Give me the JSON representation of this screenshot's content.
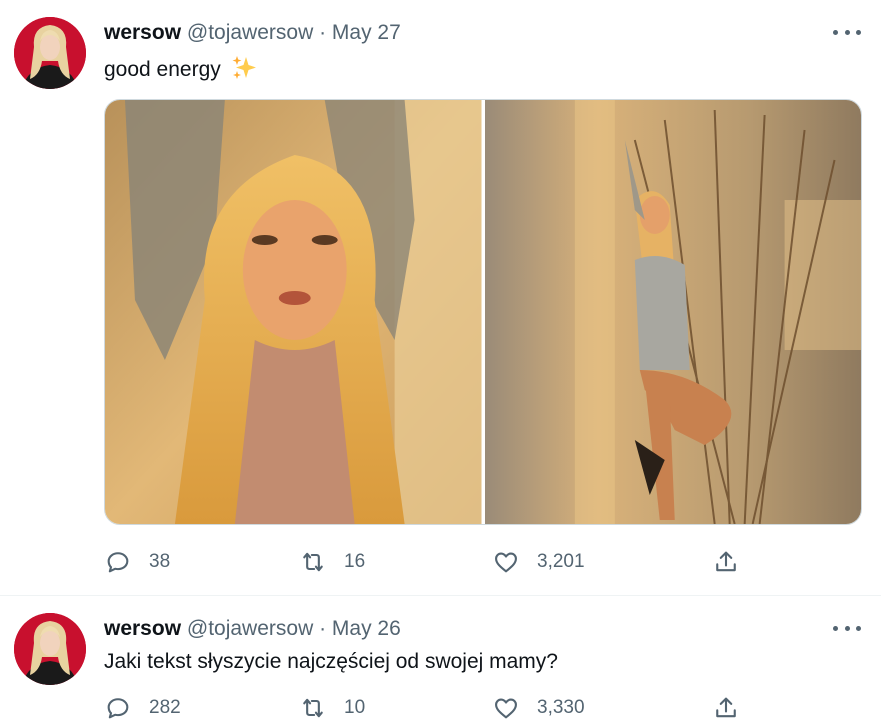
{
  "tweets": [
    {
      "author_name": "wersow",
      "handle": "@tojawersow",
      "separator": "·",
      "date": "May 27",
      "text": "good energy",
      "emoji_icon": "sparkles-icon",
      "media": [
        {
          "alt": "photo-portrait"
        },
        {
          "alt": "photo-full-body"
        }
      ],
      "reply_count": "38",
      "retweet_count": "16",
      "like_count": "3,201"
    },
    {
      "author_name": "wersow",
      "handle": "@tojawersow",
      "separator": "·",
      "date": "May 26",
      "text": "Jaki tekst słyszycie najczęściej od swojej mamy?",
      "reply_count": "282",
      "retweet_count": "10",
      "like_count": "3,330"
    }
  ],
  "colors": {
    "text_primary": "#0f1419",
    "text_secondary": "#536471",
    "avatar_bg": "#c8102e",
    "border": "#eff3f4"
  }
}
